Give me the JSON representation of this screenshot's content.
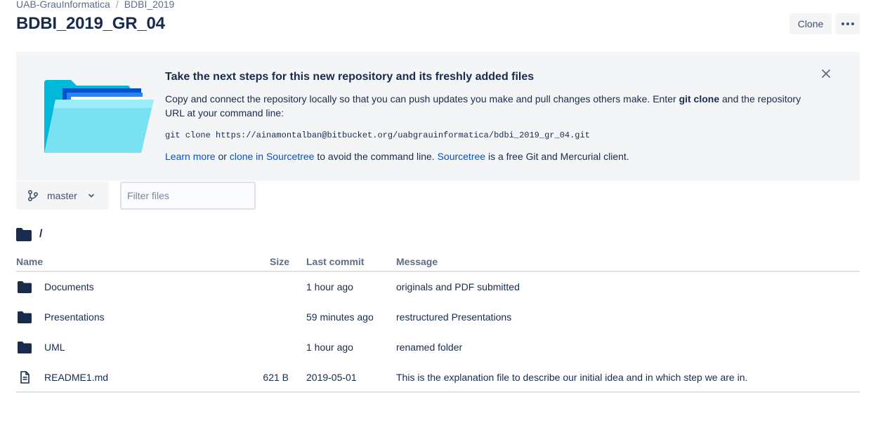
{
  "breadcrumb": {
    "workspace": "UAB-GrauInformatica",
    "separator": "/",
    "project": "BDBI_2019"
  },
  "page_title": "BDBI_2019_GR_04",
  "actions": {
    "clone_label": "Clone",
    "more_icon": "ellipsis-icon"
  },
  "banner": {
    "heading": "Take the next steps for this new repository and its freshly added files",
    "text_before": "Copy and connect the repository locally so that you can push updates you make and pull changes others make. Enter ",
    "text_bold": "git clone",
    "text_after": " and the repository URL at your command line:",
    "command": "git clone https://ainamontalban@bitbucket.org/uabgrauinformatica/bdbi_2019_gr_04.git",
    "learn_more": "Learn more",
    "or": " or ",
    "clone_in_sourcetree": "clone in Sourcetree",
    "avoid_text": " to avoid the command line. ",
    "sourcetree": "Sourcetree",
    "free_text": " is a free Git and Mercurial client.",
    "close_icon": "close-icon"
  },
  "branch": {
    "label": "master",
    "icon": "branch-icon"
  },
  "filter": {
    "placeholder": "Filter files"
  },
  "path": {
    "current": "/"
  },
  "table": {
    "headers": {
      "name": "Name",
      "size": "Size",
      "last_commit": "Last commit",
      "message": "Message"
    },
    "rows": [
      {
        "type": "folder",
        "name": "Documents",
        "size": "",
        "last_commit": "1 hour ago",
        "message": "originals and PDF submitted"
      },
      {
        "type": "folder",
        "name": "Presentations",
        "size": "",
        "last_commit": "59 minutes ago",
        "message": "restructured Presentations"
      },
      {
        "type": "folder",
        "name": "UML",
        "size": "",
        "last_commit": "1 hour ago",
        "message": "renamed folder"
      },
      {
        "type": "file",
        "name": "README1.md",
        "size": "621 B",
        "last_commit": "2019-05-01",
        "message": "This is the explanation file to describe our initial idea and in which step we are in."
      }
    ]
  },
  "colors": {
    "link": "#0052cc",
    "text": "#172b4d",
    "muted": "#5e6c84",
    "banner_bg": "#f4f5f7",
    "folder": "#172b4d"
  }
}
